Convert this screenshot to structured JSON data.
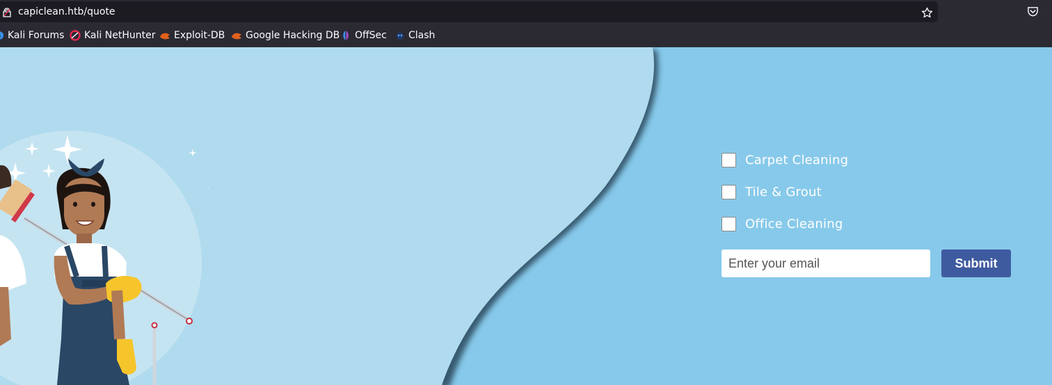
{
  "browser": {
    "url": "capiclean.htb/quote",
    "bookmarks": [
      {
        "label": "Kali Forums",
        "icon": "kali-forums-icon"
      },
      {
        "label": "Kali NetHunter",
        "icon": "kali-nethunter-icon"
      },
      {
        "label": "Exploit-DB",
        "icon": "exploit-db-icon"
      },
      {
        "label": "Google Hacking DB",
        "icon": "google-hacking-db-icon"
      },
      {
        "label": "OffSec",
        "icon": "offsec-icon"
      },
      {
        "label": "Clash",
        "icon": "clash-icon"
      }
    ]
  },
  "quote_form": {
    "services": [
      "Carpet Cleaning",
      "Tile & Grout",
      "Office Cleaning"
    ],
    "email_placeholder": "Enter your email",
    "submit_label": "Submit"
  },
  "colors": {
    "light_blue": "#b0dbee",
    "dark_blue": "#87c9ea",
    "submit": "#3f5b9f",
    "browser_chrome": "#2b2a33"
  }
}
